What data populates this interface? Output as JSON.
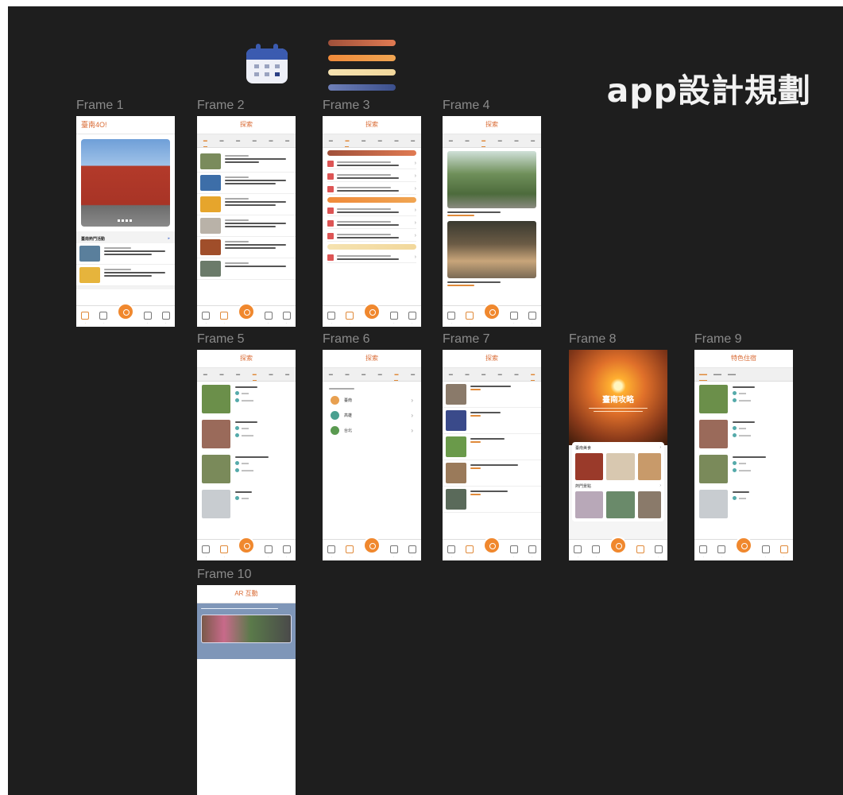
{
  "title": "app設計規劃",
  "frames": {
    "f1": {
      "label": "Frame 1",
      "header": "臺南4O!",
      "section": "臺南熱門活動"
    },
    "f2": {
      "label": "Frame 2",
      "header": "探索"
    },
    "f3": {
      "label": "Frame 3",
      "header": "探索"
    },
    "f4": {
      "label": "Frame 4",
      "header": "探索"
    },
    "f5": {
      "label": "Frame 5",
      "header": "探索"
    },
    "f6": {
      "label": "Frame 6",
      "header": "探索"
    },
    "f7": {
      "label": "Frame 7",
      "header": "探索"
    },
    "f8": {
      "label": "Frame 8",
      "hero": "臺南攻略",
      "row1": "臺南美食",
      "row2": "熱門景點"
    },
    "f9": {
      "label": "Frame 9",
      "header": "特色住宿"
    },
    "f10": {
      "label": "Frame 10",
      "header": "AR 互動"
    }
  },
  "f6_regions": [
    "臺南",
    "高雄",
    "台北"
  ],
  "colors": {
    "canvas": "#1e1e1e",
    "accent": "#e08a3a",
    "header_text": "#d96a33"
  },
  "icons": [
    "calendar-icon",
    "home-icon",
    "search-icon",
    "map-pin-icon",
    "list-icon",
    "chevron-right-icon"
  ]
}
